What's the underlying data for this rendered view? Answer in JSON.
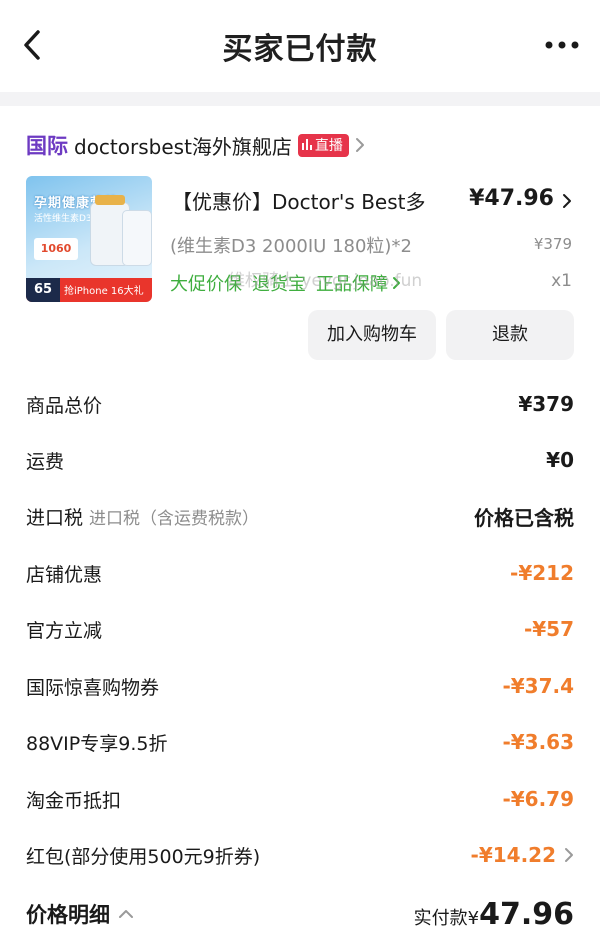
{
  "header": {
    "title": "买家已付款"
  },
  "shop": {
    "intl_label": "国际",
    "name": "doctorsbest海外旗舰店",
    "live_badge": "直播"
  },
  "product": {
    "thumb": {
      "headline": "孕期健康营养",
      "subline": "活性维生素D3",
      "price_tag": "1060",
      "foot_left": "65",
      "foot_right": "抢iPhone 16大礼"
    },
    "name": "【优惠价】Doctor's Best多",
    "price": "¥47.96",
    "spec": "(维生素D3 2000IU 180粒)*2",
    "original_price": "¥379",
    "tags": [
      "大促价保",
      "退货宝",
      "正品保障"
    ],
    "quantity": "x1",
    "watermark": "维权骑士 yevgr.joao.fun"
  },
  "actions": {
    "add_to_cart": "加入购物车",
    "refund": "退款"
  },
  "fees": [
    {
      "label": "商品总价",
      "sub": "",
      "value": "¥379",
      "negative": false,
      "chevron": false
    },
    {
      "label": "运费",
      "sub": "",
      "value": "¥0",
      "negative": false,
      "chevron": false
    },
    {
      "label": "进口税",
      "sub": "进口税（含运费税款）",
      "value": "价格已含税",
      "negative": false,
      "chevron": false
    },
    {
      "label": "店铺优惠",
      "sub": "",
      "value": "-¥212",
      "negative": true,
      "chevron": false
    },
    {
      "label": "官方立减",
      "sub": "",
      "value": "-¥57",
      "negative": true,
      "chevron": false
    },
    {
      "label": "国际惊喜购物券",
      "sub": "",
      "value": "-¥37.4",
      "negative": true,
      "chevron": false
    },
    {
      "label": "88VIP专享9.5折",
      "sub": "",
      "value": "-¥3.63",
      "negative": true,
      "chevron": false
    },
    {
      "label": "淘金币抵扣",
      "sub": "",
      "value": "-¥6.79",
      "negative": true,
      "chevron": false
    },
    {
      "label": "红包(部分使用500元9折券)",
      "sub": "",
      "value": "-¥14.22",
      "negative": true,
      "chevron": true
    }
  ],
  "footer": {
    "detail_label": "价格明细",
    "paid_label": "实付款¥",
    "paid_amount": "47.96"
  },
  "colors": {
    "accent_orange": "#f07d2c",
    "intl_purple": "#6d3ac2",
    "live_red": "#e6344a",
    "tag_green": "#3fae3f"
  }
}
